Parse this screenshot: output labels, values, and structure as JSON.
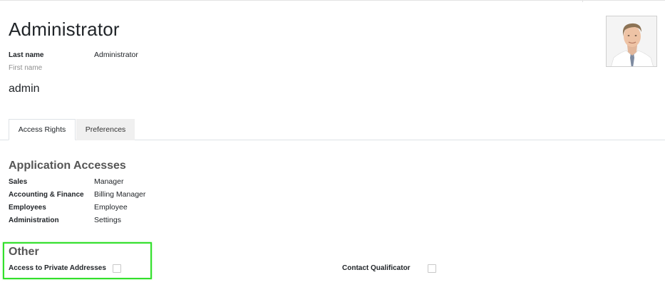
{
  "record": {
    "title": "Administrator",
    "fields": {
      "last_name_label": "Last name",
      "last_name_value": "Administrator",
      "first_name_label": "First name",
      "login_value": "admin"
    },
    "avatar_icon": "user-photo-icon"
  },
  "tabs": [
    {
      "label": "Access Rights",
      "active": true
    },
    {
      "label": "Preferences",
      "active": false
    }
  ],
  "application_accesses": {
    "title": "Application Accesses",
    "rows": [
      {
        "label": "Sales",
        "value": "Manager"
      },
      {
        "label": "Accounting & Finance",
        "value": "Billing Manager"
      },
      {
        "label": "Employees",
        "value": "Employee"
      },
      {
        "label": "Administration",
        "value": "Settings"
      }
    ]
  },
  "other": {
    "title": "Other",
    "items": [
      {
        "label": "Access to Private Addresses",
        "checked": false
      },
      {
        "label": "Contact Qualificator",
        "checked": false
      }
    ]
  },
  "colors": {
    "highlight": "#33e02c",
    "tab_inactive_bg": "#f0f0f0",
    "border": "#dee2e6"
  }
}
